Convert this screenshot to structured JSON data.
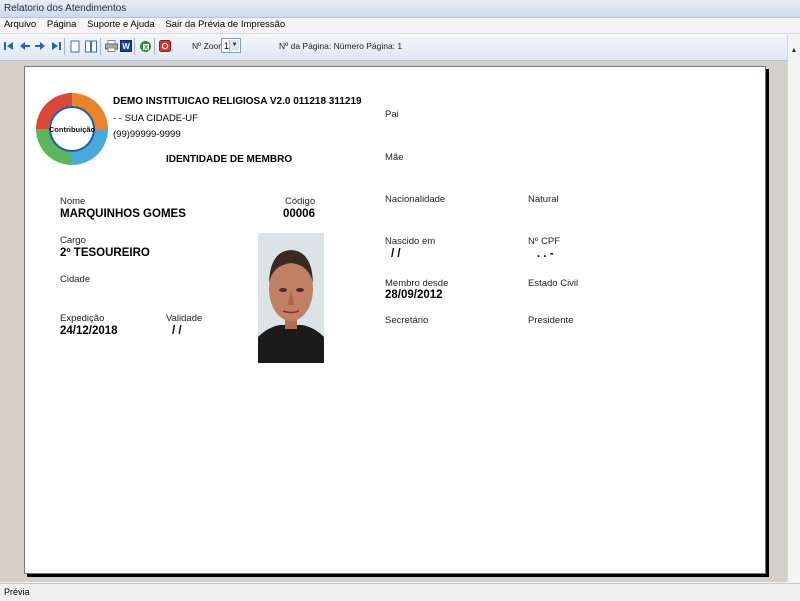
{
  "window": {
    "title": "Relatorio dos Atendimentos"
  },
  "menu": {
    "items": [
      "Arquivo",
      "Página",
      "Suporte e Ajuda",
      "Sair da Prévia de Impressão"
    ]
  },
  "toolbar": {
    "zoom_label": "Nº Zoom",
    "zoom_value": "1",
    "page_info": "Nº da Página: Número Página: 1",
    "icons": [
      "first-page-icon",
      "prev-page-icon",
      "next-page-icon",
      "last-page-icon",
      "single-page-icon",
      "two-pages-icon",
      "print-icon",
      "word-export-icon",
      "excel-export-icon",
      "pdf-export-icon"
    ]
  },
  "report": {
    "org_name": "DEMO INSTITUICAO RELIGIOSA V2.0 011218 311219",
    "org_address": "-  - SUA CIDADE-UF",
    "org_phone": "(99)99999-9999",
    "logo_text": "Contribuição",
    "doc_title": "IDENTIDADE DE MEMBRO",
    "fields": {
      "nome_label": "Nome",
      "nome_value": "MARQUINHOS GOMES",
      "codigo_label": "Código",
      "codigo_value": "00006",
      "cargo_label": "Cargo",
      "cargo_value": "2º TESOUREIRO",
      "cidade_label": "Cidade",
      "expedicao_label": "Expedição",
      "expedicao_value": "24/12/2018",
      "validade_label": "Validade",
      "validade_value": "/  /",
      "pai_label": "Pai",
      "mae_label": "Mãe",
      "nacionalidade_label": "Nacionalidade",
      "natural_label": "Natural",
      "nascido_label": "Nascido em",
      "nascido_value": "/  /",
      "cpf_label": "Nº CPF",
      "cpf_value": ".   .   -",
      "membro_desde_label": "Membro desde",
      "membro_desde_value": "28/09/2012",
      "estado_civil_label": "Estado Civil",
      "secretario_label": "Secretário",
      "presidente_label": "Presidente"
    }
  },
  "status": {
    "text": "Prévia"
  },
  "colors": {
    "accent": "#3a6fc4",
    "paper": "#ffffff",
    "viewport": "#d4d0c8"
  }
}
